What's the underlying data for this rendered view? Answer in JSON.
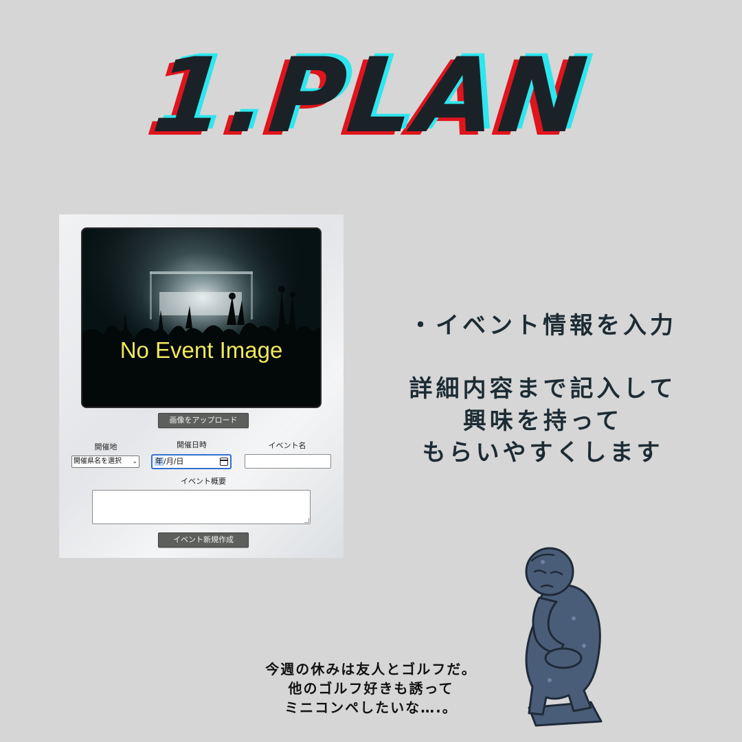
{
  "title": "1.PLAN",
  "form": {
    "image_placeholder_text": "No Event Image",
    "upload_button": "画像をアップロード",
    "labels": {
      "place": "開催地",
      "date": "開催日時",
      "event_name": "イベント名",
      "description": "イベント概要"
    },
    "prefecture_select": "開催県名を選択",
    "date_input": {
      "year": "年",
      "rest": "/月/日"
    },
    "event_name_value": "",
    "description_value": "",
    "create_button": "イベント新規作成"
  },
  "side": {
    "bullet": "・イベント情報を入力",
    "lines": [
      "詳細内容まで記入して",
      "興味を持って",
      "もらいやすくします"
    ]
  },
  "speech": {
    "lines": [
      "今週の休みは友人とゴルフだ。",
      "他のゴルフ好きも誘って",
      "ミニコンペしたいな….。"
    ]
  },
  "icons": {
    "statue": "thinker-statue-icon",
    "calendar": "calendar-icon"
  },
  "colors": {
    "background": "#d6d6d6",
    "title": "#1a2228",
    "title_red": "#e0141c",
    "title_cyan": "#2ee6ee",
    "placeholder_text": "#f0e95e",
    "button": "#5d5f5c",
    "side_text": "#1d2c34"
  }
}
